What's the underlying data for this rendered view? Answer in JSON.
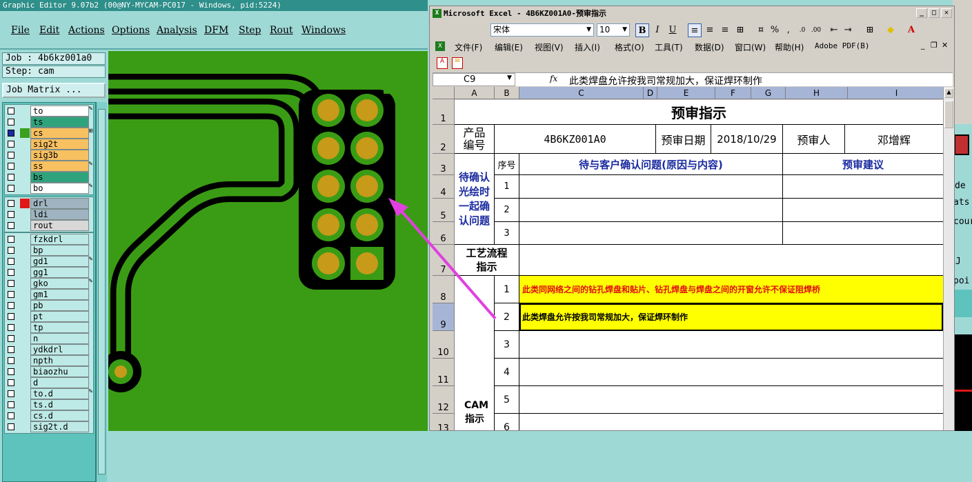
{
  "genesis": {
    "title": "Graphic Editor 9.07b2 (00@NY-MYCAM-PC017 - Windows, pid:5224)",
    "menu": [
      "File",
      "Edit",
      "Actions",
      "Options",
      "Analysis",
      "DFM",
      "Step",
      "Rout",
      "Windows"
    ],
    "job_label": "Job : 4b6kz001a0",
    "step_label": "Step: cam",
    "job_matrix_button": "Job Matrix ...",
    "layers_group1": [
      {
        "name": "to",
        "color": "#ffffff",
        "marker": "✎"
      },
      {
        "name": "ts",
        "color": "#2fa37c",
        "marker": ""
      },
      {
        "name": "cs",
        "color": "#f7c060",
        "marker": "⊞",
        "selected": true,
        "swatch": "#3aa020"
      },
      {
        "name": "sig2t",
        "color": "#f7c060",
        "marker": ""
      },
      {
        "name": "sig3b",
        "color": "#f7c060",
        "marker": ""
      },
      {
        "name": "ss",
        "color": "#f7c060",
        "marker": "✎"
      },
      {
        "name": "bs",
        "color": "#2fa37c",
        "marker": ""
      },
      {
        "name": "bo",
        "color": "#ffffff",
        "marker": "✎"
      }
    ],
    "layers_group2": [
      {
        "name": "drl",
        "color": "#9fb4c0",
        "marker": "",
        "swatch": "#e01818"
      },
      {
        "name": "ldi",
        "color": "#9fb4c0",
        "marker": ""
      },
      {
        "name": "rout",
        "color": "#d8d8d8",
        "marker": ""
      }
    ],
    "layers_group3": [
      {
        "name": "fzkdrl",
        "marker": ""
      },
      {
        "name": "bp",
        "marker": ""
      },
      {
        "name": "gd1",
        "marker": "✎"
      },
      {
        "name": "gg1",
        "marker": ""
      },
      {
        "name": "gko",
        "marker": "✎"
      },
      {
        "name": "gm1",
        "marker": ""
      },
      {
        "name": "pb",
        "marker": ""
      },
      {
        "name": "pt",
        "marker": ""
      },
      {
        "name": "tp",
        "marker": ""
      },
      {
        "name": "n",
        "marker": ""
      },
      {
        "name": "ydkdrl",
        "marker": ""
      },
      {
        "name": "npth",
        "marker": ""
      },
      {
        "name": "biaozhu",
        "marker": ""
      },
      {
        "name": "d",
        "marker": ""
      },
      {
        "name": "to.d",
        "marker": "✎"
      },
      {
        "name": "ts.d",
        "marker": ""
      },
      {
        "name": "cs.d",
        "marker": ""
      },
      {
        "name": "sig2t.d",
        "marker": ""
      }
    ]
  },
  "excel": {
    "title": "Microsoft Excel - 4B6KZ001A0-预审指示",
    "font_name": "宋体",
    "font_size": "10",
    "format_buttons": [
      "B",
      "I",
      "U"
    ],
    "menu": [
      "文件(F)",
      "编辑(E)",
      "视图(V)",
      "插入(I)",
      "格式(O)",
      "工具(T)",
      "数据(D)",
      "窗口(W)",
      "帮助(H)",
      "Adobe PDF(B)"
    ],
    "name_box": "C9",
    "fx_label": "fx",
    "formula_value": "此类焊盘允许按我司常规加大，保证焊环制作",
    "columns": [
      "A",
      "B",
      "C",
      "D",
      "E",
      "F",
      "G",
      "H",
      "I"
    ],
    "rows": [
      "1",
      "2",
      "3",
      "4",
      "5",
      "6",
      "7",
      "8",
      "9",
      "10",
      "11",
      "12",
      "13"
    ],
    "sheet": {
      "title": "预审指示",
      "product_no_label": "产品编号",
      "product_no": "4B6KZ001A0",
      "review_date_label": "预审日期",
      "review_date": "2018/10/29",
      "reviewer_label": "预审人",
      "reviewer": "邓增辉",
      "seq_header": "序号",
      "issues_header": "待与客户确认问题(原因与内容)",
      "advice_header": "预审建议",
      "pending_section": "待确认光绘时一起确认问题",
      "pending_rows": [
        "1",
        "2",
        "3"
      ],
      "process_label": "工艺流程指示",
      "cam_label": "CAM指示",
      "cam_rows": [
        {
          "no": "1",
          "text": "此类同网络之间的钻孔焊盘和贴片、钻孔焊盘与焊盘之间的开窗允许不保证阻焊桥"
        },
        {
          "no": "2",
          "text": "此类焊盘允许按我司常规加大，保证焊环制作"
        },
        {
          "no": "3",
          "text": ""
        },
        {
          "no": "4",
          "text": ""
        },
        {
          "no": "5",
          "text": ""
        },
        {
          "no": "6",
          "text": ""
        }
      ]
    }
  },
  "background_right": [
    "de",
    "ats",
    "cour",
    "J",
    "poi"
  ],
  "colors": {
    "board_green": "#3a9c14",
    "copper_pad": "#c79a1a",
    "arrow": "#e040e0",
    "highlight_yellow": "#ffff00",
    "header_blue": "#1a2aa0"
  }
}
